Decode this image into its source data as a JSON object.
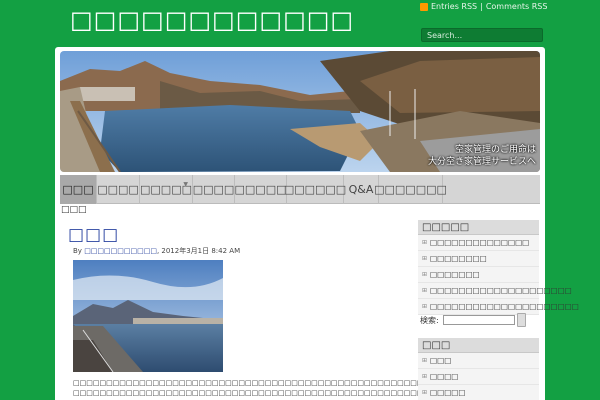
{
  "site": {
    "title": "□□□□□□□□□□□□"
  },
  "rss": {
    "entries": "Entries RSS",
    "comments": "Comments RSS",
    "separator": "|"
  },
  "search": {
    "placeholder": "Search..."
  },
  "banner": {
    "caption_line1": "空家管理のご用命は",
    "caption_line2": "大分空き家管理サービスへ"
  },
  "nav": {
    "items": [
      {
        "label": "□□□"
      },
      {
        "label": "□□□□"
      },
      {
        "label": "□□□□□"
      },
      {
        "label": "□□□□"
      },
      {
        "label": "□□□□□"
      },
      {
        "label": "□□□□□□"
      },
      {
        "label": "Q&A"
      },
      {
        "label": "□□□□□□□"
      }
    ]
  },
  "breadcrumb": "□□□",
  "post": {
    "title": "□□□",
    "by": "By",
    "author": "□□□□□□□□□□□",
    "date": ", 2012年3月1日 8:42 AM",
    "text_line1": "□□□□□□□□□□□□□□□□□□□□□□□□□□□□□□□□□□□□□□□□□□□□□□□□□□□□□□□□□",
    "text_line2": "□□□□□□□□□□□□□□□□□□□□□□□□□□□□□□□□□□□□□□□□□□□□□□□□□□□□□□□□□□□□□"
  },
  "sidebar": {
    "widget1": {
      "title": "□□□□□",
      "items": [
        "□□□□□□□□□□□□□□",
        "□□□□□□□□",
        "□□□□□□□",
        "□□□□□□□□□□□□□□□□□□□□",
        "□□□□□□□□□□□□□□□□□□□□□"
      ]
    },
    "search_label": "検索:",
    "widget2": {
      "title": "□□□",
      "items": [
        "□□□",
        "□□□□",
        "□□□□□",
        "□□□□□□"
      ]
    }
  },
  "colors": {
    "background": "#13a043",
    "nav": "#d5d5d5",
    "link": "#2a43a0"
  }
}
